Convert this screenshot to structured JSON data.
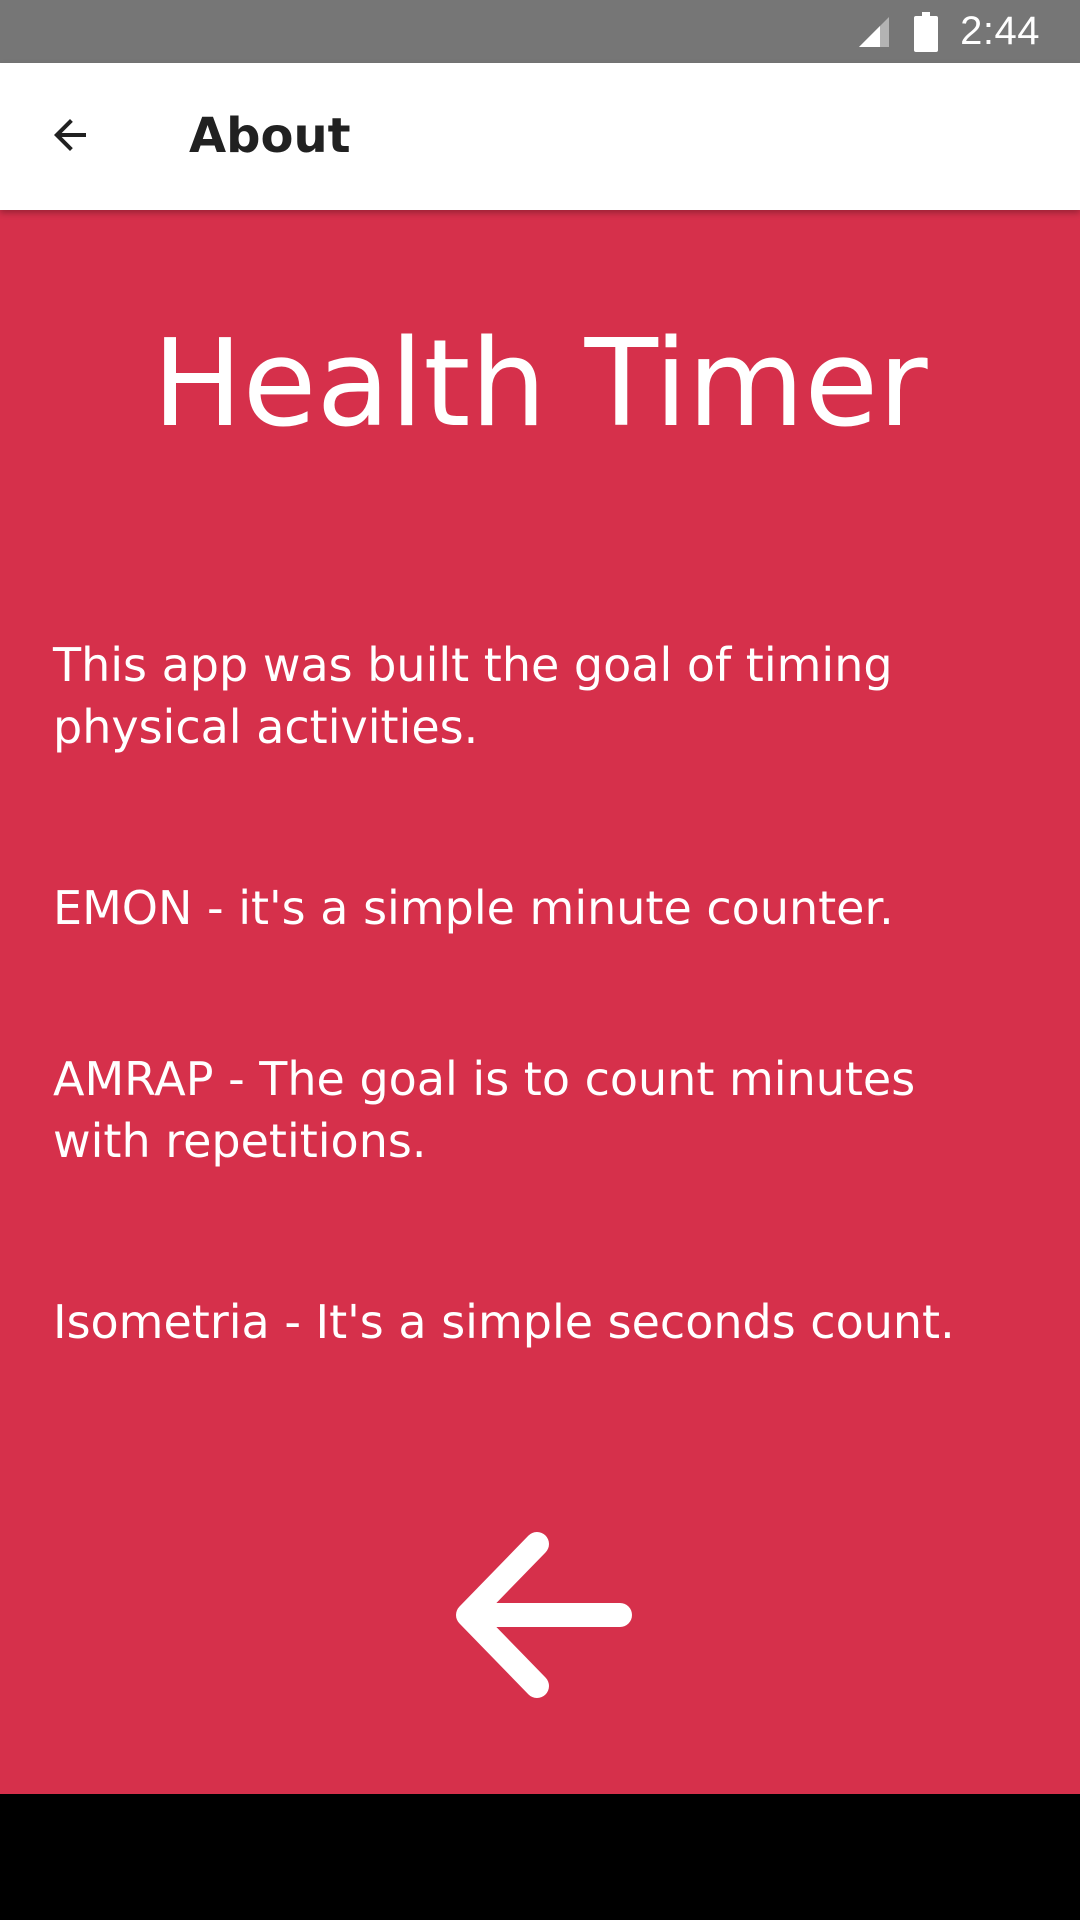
{
  "status_bar": {
    "time": "2:44",
    "signal_icon": "cellular-signal-icon",
    "battery_icon": "battery-icon",
    "background": "#767676"
  },
  "app_bar": {
    "title": "About",
    "back_icon": "arrow-back-icon"
  },
  "content": {
    "background": "#d6304b",
    "app_name": "Health Timer",
    "paragraphs": [
      "This app was built the goal of timing physical activities.",
      "EMON - it's a simple minute counter.",
      "AMRAP - The goal is to count minutes with repetitions.",
      "Isometria - It's a simple seconds count."
    ],
    "back_button_icon": "arrow-back-icon"
  }
}
